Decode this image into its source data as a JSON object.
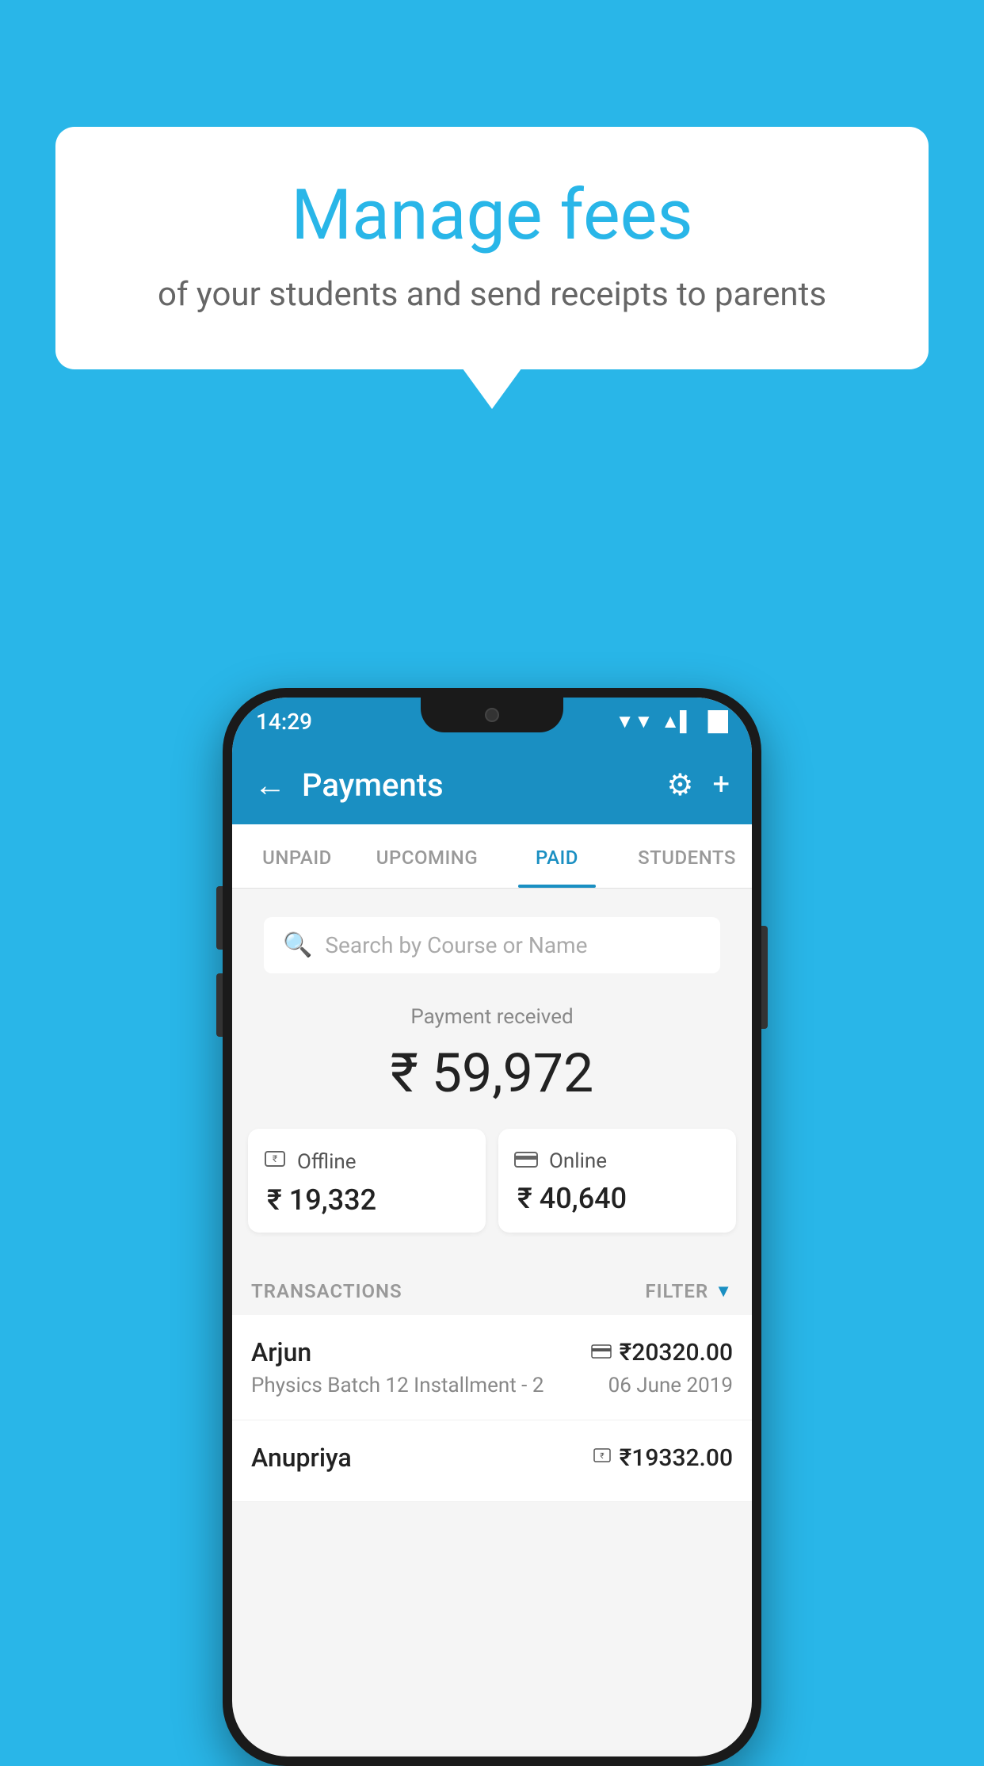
{
  "background_color": "#29b6e8",
  "bubble": {
    "title": "Manage fees",
    "subtitle": "of your students and send receipts to parents"
  },
  "status_bar": {
    "time": "14:29",
    "wifi_icon": "▼",
    "signal_icon": "▲",
    "battery_icon": "▌"
  },
  "app_bar": {
    "title": "Payments",
    "back_icon": "←",
    "settings_icon": "⚙",
    "add_icon": "+"
  },
  "tabs": [
    {
      "label": "UNPAID",
      "active": false
    },
    {
      "label": "UPCOMING",
      "active": false
    },
    {
      "label": "PAID",
      "active": true
    },
    {
      "label": "STUDENTS",
      "active": false
    }
  ],
  "search": {
    "placeholder": "Search by Course or Name"
  },
  "payment_summary": {
    "label": "Payment received",
    "total": "₹ 59,972",
    "offline": {
      "icon": "▣",
      "label": "Offline",
      "amount": "₹ 19,332"
    },
    "online": {
      "icon": "▬",
      "label": "Online",
      "amount": "₹ 40,640"
    }
  },
  "transactions": {
    "label": "TRANSACTIONS",
    "filter_label": "FILTER",
    "rows": [
      {
        "name": "Arjun",
        "course": "Physics Batch 12 Installment - 2",
        "amount": "₹20320.00",
        "date": "06 June 2019",
        "payment_icon": "▬"
      },
      {
        "name": "Anupriya",
        "course": "",
        "amount": "₹19332.00",
        "date": "",
        "payment_icon": "▣"
      }
    ]
  }
}
